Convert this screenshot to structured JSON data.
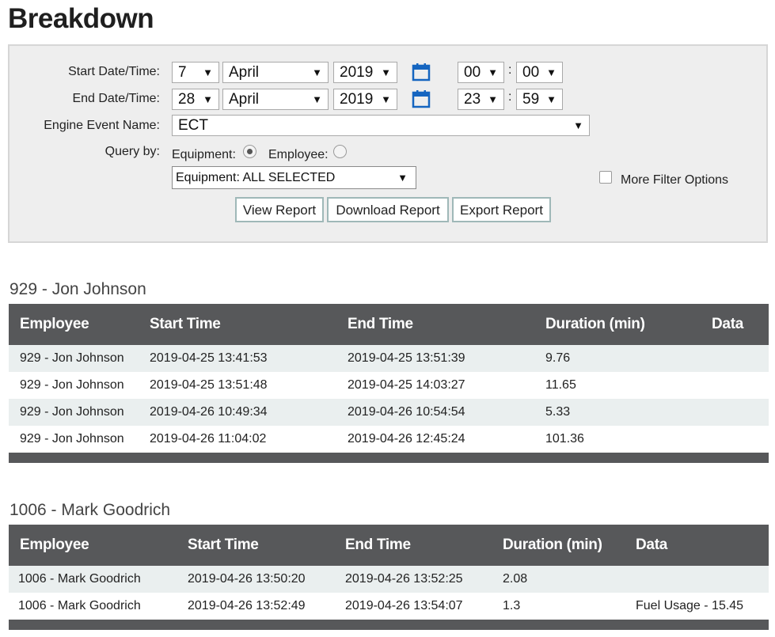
{
  "page": {
    "title": "Breakdown"
  },
  "filters": {
    "start_label": "Start Date/Time:",
    "start": {
      "day": "7",
      "month": "April",
      "year": "2019",
      "hour": "00",
      "minute": "00"
    },
    "end_label": "End Date/Time:",
    "end": {
      "day": "28",
      "month": "April",
      "year": "2019",
      "hour": "23",
      "minute": "59"
    },
    "time_separator": ":",
    "engine_event_label": "Engine Event Name:",
    "engine_event_value": "ECT",
    "query_by_label": "Query by:",
    "query_options": [
      {
        "label": "Equipment:",
        "selected": true
      },
      {
        "label": "Employee:",
        "selected": false
      }
    ],
    "equipment_select_value": "Equipment: ALL SELECTED",
    "more_filter_label": "More Filter Options",
    "more_filter_checked": false,
    "dropdown_glyph": "▼"
  },
  "buttons": {
    "view_report": "View Report",
    "download_report": "Download Report",
    "export_report": "Export Report"
  },
  "groups": [
    {
      "title": "929 - Jon Johnson",
      "columns": [
        "Employee",
        "Start Time",
        "End Time",
        "Duration (min)",
        "Data"
      ],
      "rows": [
        [
          "929 - Jon Johnson",
          "2019-04-25 13:41:53",
          "2019-04-25 13:51:39",
          "9.76",
          ""
        ],
        [
          "929 - Jon Johnson",
          "2019-04-25 13:51:48",
          "2019-04-25 14:03:27",
          "11.65",
          ""
        ],
        [
          "929 - Jon Johnson",
          "2019-04-26 10:49:34",
          "2019-04-26 10:54:54",
          "5.33",
          ""
        ],
        [
          "929 - Jon Johnson",
          "2019-04-26 11:04:02",
          "2019-04-26 12:45:24",
          "101.36",
          ""
        ]
      ]
    },
    {
      "title": "1006 - Mark Goodrich",
      "columns": [
        "Employee",
        "Start Time",
        "End Time",
        "Duration (min)",
        "Data"
      ],
      "rows": [
        [
          "1006 - Mark Goodrich",
          "2019-04-26 13:50:20",
          "2019-04-26 13:52:25",
          "2.08",
          ""
        ],
        [
          "1006 - Mark Goodrich",
          "2019-04-26 13:52:49",
          "2019-04-26 13:54:07",
          "1.3",
          "Fuel Usage - 15.45"
        ]
      ]
    }
  ],
  "colors": {
    "header_bg": "#57585a",
    "odd_row_bg": "#eaefef",
    "calendar_icon": "#1565c0",
    "panel_bg": "#eeeeee"
  }
}
